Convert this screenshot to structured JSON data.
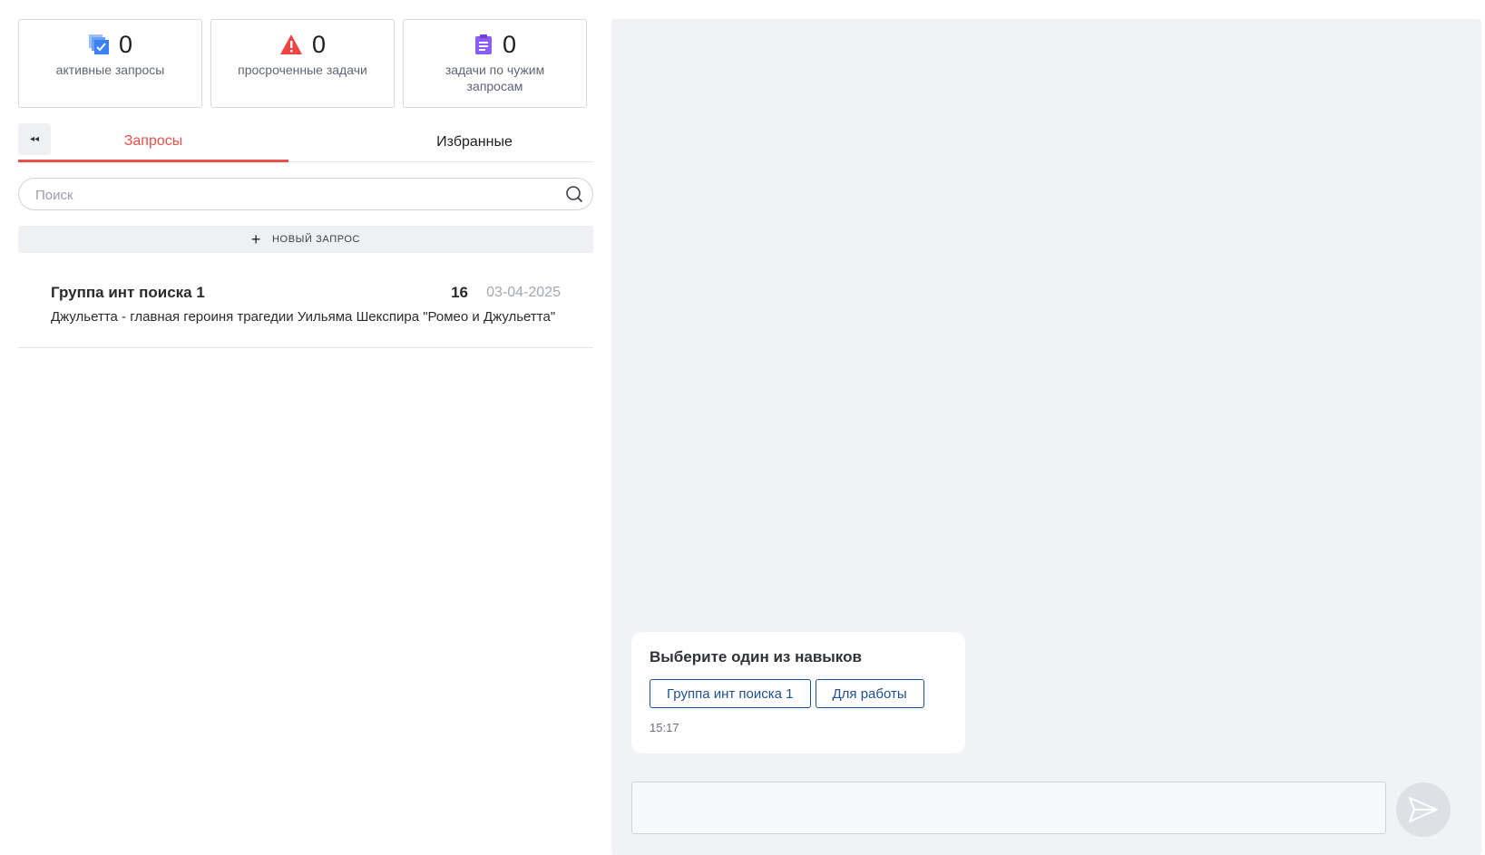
{
  "stats": [
    {
      "icon": "active-requests-icon",
      "count": "0",
      "label": "активные запросы",
      "color": "#3b82f6"
    },
    {
      "icon": "warning-icon",
      "count": "0",
      "label": "просроченные задачи",
      "color": "#ef4444"
    },
    {
      "icon": "clipboard-icon",
      "count": "0",
      "label": "задачи по чужим запросам",
      "color": "#8b5cf6"
    }
  ],
  "tabs": {
    "collapse_icon": "double-chevron-left-icon",
    "requests": "Запросы",
    "favorites": "Избранные",
    "active_color": "#e8504a"
  },
  "search": {
    "placeholder": "Поиск",
    "value": ""
  },
  "new_request": {
    "label": "НОВЫЙ ЗАПРОС"
  },
  "requests": [
    {
      "title": "Группа инт поиска 1",
      "count": "16",
      "date": "03-04-2025",
      "preview": "Джульетта - главная героиня трагедии Уильяма Шекспира \"Ромео и Джульетта\""
    }
  ],
  "chat": {
    "message": {
      "title": "Выберите один из навыков",
      "skills": [
        "Группа инт поиска 1",
        "Для работы"
      ],
      "time": "15:17"
    },
    "composer": {
      "placeholder": "",
      "value": ""
    },
    "send_icon": "send-icon"
  }
}
